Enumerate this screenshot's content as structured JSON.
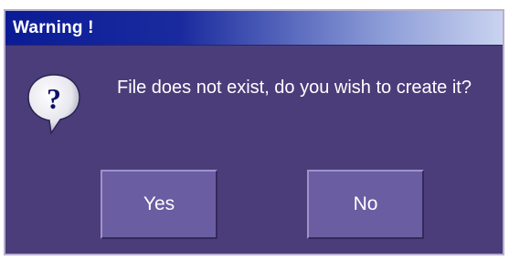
{
  "dialog": {
    "title": "Warning !",
    "message": "File does not exist, do you wish to create it?",
    "icon": "question-bubble-icon",
    "buttons": {
      "yes_label": "Yes",
      "no_label": "No"
    }
  },
  "colors": {
    "dialog_background": "#4a3d7a",
    "button_background": "#6a5da2",
    "title_bar_start": "#0b1b96",
    "title_bar_end": "#c9d3f0",
    "text": "#ffffff"
  }
}
